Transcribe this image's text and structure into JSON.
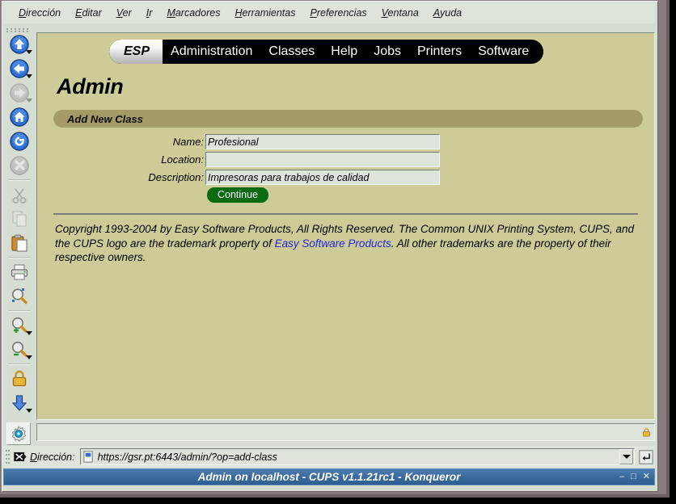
{
  "window": {
    "title": "Admin on localhost - CUPS v1.1.21rc1 - Konqueror",
    "minimize_label": "–",
    "maximize_label": "□",
    "close_label": "✕"
  },
  "menubar": {
    "items": [
      {
        "accel": "D",
        "rest": "irección"
      },
      {
        "accel": "E",
        "rest": "ditar"
      },
      {
        "accel": "V",
        "rest": "er"
      },
      {
        "accel": "I",
        "rest": "r"
      },
      {
        "accel": "M",
        "rest": "arcadores"
      },
      {
        "accel": "H",
        "rest": "erramientas"
      },
      {
        "accel": "P",
        "rest": "referencias"
      },
      {
        "accel": "V",
        "rest": "entana"
      },
      {
        "accel": "A",
        "rest": "yuda"
      }
    ]
  },
  "toolbar": {
    "buttons": [
      {
        "name": "up-arrow-icon",
        "label": "Arriba",
        "enabled": true,
        "has_menu": true
      },
      {
        "name": "back-arrow-icon",
        "label": "Atrás",
        "enabled": true,
        "has_menu": true
      },
      {
        "name": "forward-arrow-icon",
        "label": "Adelante",
        "enabled": false,
        "has_menu": true
      },
      {
        "name": "home-icon",
        "label": "Inicio",
        "enabled": true,
        "has_menu": false
      },
      {
        "name": "reload-icon",
        "label": "Recargar",
        "enabled": true,
        "has_menu": false
      },
      {
        "name": "stop-icon",
        "label": "Detener",
        "enabled": false,
        "has_menu": false
      },
      {
        "name": "cut-scissors-icon",
        "label": "Cortar",
        "enabled": false,
        "has_menu": false
      },
      {
        "name": "copy-icon",
        "label": "Copiar",
        "enabled": false,
        "has_menu": false
      },
      {
        "name": "paste-clipboard-icon",
        "label": "Pegar",
        "enabled": true,
        "has_menu": false
      },
      {
        "name": "print-icon",
        "label": "Imprimir",
        "enabled": true,
        "has_menu": false
      },
      {
        "name": "find-icon",
        "label": "Buscar",
        "enabled": true,
        "has_menu": false
      },
      {
        "name": "zoom-in-icon",
        "label": "Ampliar",
        "enabled": true,
        "has_menu": true
      },
      {
        "name": "zoom-out-icon",
        "label": "Reducir",
        "enabled": true,
        "has_menu": true
      },
      {
        "name": "lock-icon",
        "label": "Seguridad",
        "enabled": true,
        "has_menu": false
      },
      {
        "name": "download-arrow-icon",
        "label": "Descargas",
        "enabled": true,
        "has_menu": true
      }
    ],
    "settings_button": {
      "name": "gear-settings-icon",
      "label": "Configurar"
    }
  },
  "page": {
    "tabs": [
      {
        "label": "ESP",
        "active": true
      },
      {
        "label": "Administration",
        "active": false
      },
      {
        "label": "Classes",
        "active": false
      },
      {
        "label": "Help",
        "active": false
      },
      {
        "label": "Jobs",
        "active": false
      },
      {
        "label": "Printers",
        "active": false
      },
      {
        "label": "Software",
        "active": false
      }
    ],
    "title": "Admin",
    "section_header": "Add New Class",
    "form": {
      "fields": [
        {
          "label": "Name:",
          "value": "Profesional",
          "placeholder": ""
        },
        {
          "label": "Location:",
          "value": "",
          "placeholder": ""
        },
        {
          "label": "Description:",
          "value": "Impresoras para trabajos de calidad",
          "placeholder": ""
        }
      ],
      "submit_label": "Continue"
    },
    "copyright": {
      "part1": "Copyright 1993-2004 by Easy Software Products, All Rights Reserved. The Common UNIX Printing System, CUPS, and the CUPS logo are the trademark property of ",
      "link": "Easy Software Products",
      "part2": ". All other trademarks are the property of their respective owners."
    }
  },
  "statusbar": {
    "message": "",
    "ssl_icon": "lock-icon"
  },
  "locationbar": {
    "clear_icon": "clear-location-icon",
    "label_accel": "D",
    "label_rest": "irección:",
    "favicon": "document-icon",
    "url": "https://gsr.pt:6443/admin/?op=add-class",
    "placeholder": "",
    "go_icon": "go-enter-icon"
  },
  "colors": {
    "page_background": "#cdcc99",
    "section_bar": "#a39b68",
    "tab_bar": "#000000",
    "continue_button": "#0a6b12",
    "link": "#2424d8",
    "titlebar": "#3b6a9c",
    "chrome": "#dde4da",
    "frame": "#8a7b7e"
  }
}
